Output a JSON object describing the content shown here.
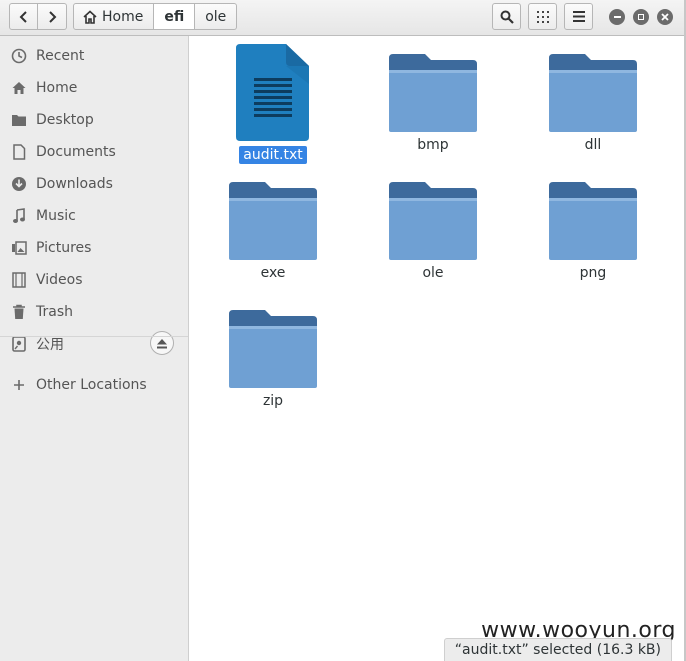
{
  "toolbar": {
    "back_icon": "chevron-left-icon",
    "forward_icon": "chevron-right-icon",
    "search_icon": "search-icon",
    "view_icon": "grid-view-icon",
    "menu_icon": "hamburger-menu-icon"
  },
  "breadcrumbs": [
    {
      "label": "Home",
      "icon": "home-icon"
    },
    {
      "label": "efi"
    },
    {
      "label": "ole"
    }
  ],
  "window_controls": [
    "minimize-icon",
    "maximize-icon",
    "close-icon"
  ],
  "sidebar": {
    "items": [
      {
        "label": "Recent",
        "icon": "clock-icon"
      },
      {
        "label": "Home",
        "icon": "home-icon"
      },
      {
        "label": "Desktop",
        "icon": "folder-icon"
      },
      {
        "label": "Documents",
        "icon": "document-icon"
      },
      {
        "label": "Downloads",
        "icon": "download-icon"
      },
      {
        "label": "Music",
        "icon": "music-note-icon"
      },
      {
        "label": "Pictures",
        "icon": "picture-icon"
      },
      {
        "label": "Videos",
        "icon": "film-icon"
      },
      {
        "label": "Trash",
        "icon": "trash-icon"
      },
      {
        "label": "公用",
        "icon": "drive-icon"
      }
    ],
    "other_locations": {
      "label": "Other Locations",
      "icon": "plus-icon"
    }
  },
  "files": [
    {
      "name": "audit.txt",
      "type": "text-file",
      "selected": true
    },
    {
      "name": "bmp",
      "type": "folder"
    },
    {
      "name": "dll",
      "type": "folder"
    },
    {
      "name": "exe",
      "type": "folder"
    },
    {
      "name": "ole",
      "type": "folder"
    },
    {
      "name": "png",
      "type": "folder"
    },
    {
      "name": "zip",
      "type": "folder"
    }
  ],
  "status_bar": {
    "text": "“audit.txt” selected  (16.3 kB)"
  },
  "watermark": {
    "text": "www.wooyun.org"
  },
  "colors": {
    "folder_front": "#6fa0d3",
    "folder_back": "#3d6a9c",
    "selection": "#3584e4",
    "text_file": "#1f7fbf"
  }
}
